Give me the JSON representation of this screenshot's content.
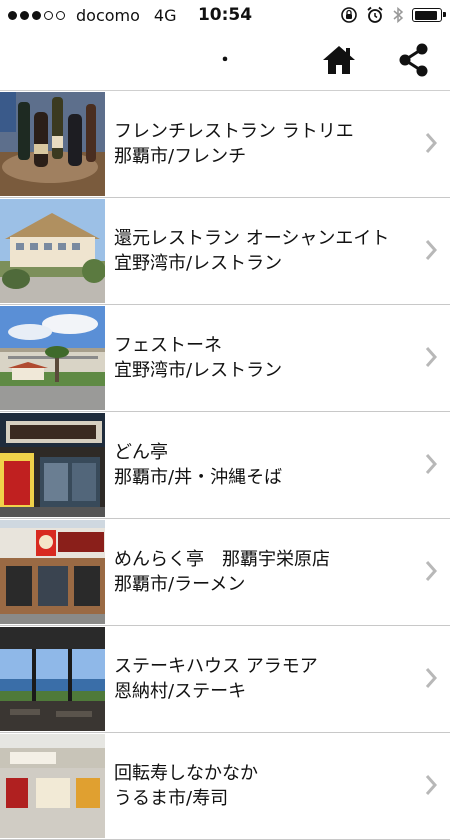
{
  "status_bar": {
    "carrier": "docomo",
    "network": "4G",
    "time": "10:54",
    "signal_bars_filled": 3,
    "signal_bars_total": 5,
    "battery_level": 0.9,
    "icons": [
      "orientation-lock-icon",
      "alarm-icon",
      "bluetooth-icon",
      "battery-icon"
    ]
  },
  "navbar": {
    "title": "・",
    "home_icon": "home-icon",
    "share_icon": "share-icon"
  },
  "restaurants": [
    {
      "name": "フレンチレストラン ラトリエ",
      "category": "那覇市/フレンチ",
      "thumbnail": "wine-bottles-photo"
    },
    {
      "name": "還元レストラン オーシャンエイト",
      "category": "宜野湾市/レストラン",
      "thumbnail": "hotel-building-photo"
    },
    {
      "name": "フェストーネ",
      "category": "宜野湾市/レストラン",
      "thumbnail": "seaside-building-photo"
    },
    {
      "name": "どん亭",
      "category": "那覇市/丼・沖縄そば",
      "thumbnail": "curry-shop-photo"
    },
    {
      "name": "めんらく亭　那覇宇栄原店",
      "category": "那覇市/ラーメン",
      "thumbnail": "ramen-shop-photo"
    },
    {
      "name": "ステーキハウス アラモア",
      "category": "恩納村/ステーキ",
      "thumbnail": "ocean-view-window-photo"
    },
    {
      "name": "回転寿しなかなか",
      "category": "うるま市/寿司",
      "thumbnail": "sushi-shop-photo"
    }
  ],
  "colors": {
    "chevron": "#b8b8b8",
    "divider": "#c8c8c8",
    "icon": "#111111"
  }
}
